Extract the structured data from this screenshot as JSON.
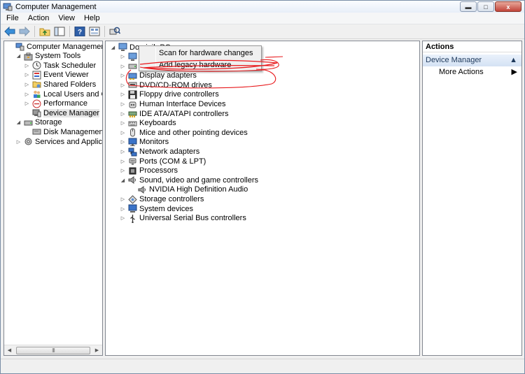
{
  "window": {
    "title": "Computer Management",
    "controls": {
      "minimize": "▬",
      "maximize": "□",
      "close": "x"
    }
  },
  "menu": [
    "File",
    "Action",
    "View",
    "Help"
  ],
  "toolbar": {
    "buttons": [
      "back-arrow-icon",
      "forward-arrow-icon",
      "up-folder-icon",
      "show-hide-tree-icon",
      "help-icon",
      "properties-icon",
      "scan-hardware-icon"
    ]
  },
  "left_tree": [
    {
      "label": "Computer Management (Local",
      "level": 0,
      "toggle": "",
      "icon": "computer-management-icon"
    },
    {
      "label": "System Tools",
      "level": 1,
      "toggle": "◢",
      "icon": "toolbox-icon"
    },
    {
      "label": "Task Scheduler",
      "level": 2,
      "toggle": "▷",
      "icon": "clock-icon"
    },
    {
      "label": "Event Viewer",
      "level": 2,
      "toggle": "▷",
      "icon": "event-viewer-icon"
    },
    {
      "label": "Shared Folders",
      "level": 2,
      "toggle": "▷",
      "icon": "shared-folder-icon"
    },
    {
      "label": "Local Users and Groups",
      "level": 2,
      "toggle": "▷",
      "icon": "users-icon"
    },
    {
      "label": "Performance",
      "level": 2,
      "toggle": "▷",
      "icon": "performance-icon"
    },
    {
      "label": "Device Manager",
      "level": 2,
      "toggle": "",
      "icon": "device-manager-icon",
      "selected": true
    },
    {
      "label": "Storage",
      "level": 1,
      "toggle": "◢",
      "icon": "storage-icon"
    },
    {
      "label": "Disk Management",
      "level": 2,
      "toggle": "",
      "icon": "disk-icon"
    },
    {
      "label": "Services and Applications",
      "level": 1,
      "toggle": "▷",
      "icon": "services-icon"
    }
  ],
  "left_scroll": {
    "grip": "III",
    "left": "◀",
    "right": "▶"
  },
  "device_tree": {
    "root": {
      "label": "Dominik-PC",
      "toggle": "◢"
    },
    "items": [
      {
        "label": "C",
        "toggle": "▷",
        "icon": "computer-icon",
        "level": 1
      },
      {
        "label": "Di",
        "toggle": "▷",
        "icon": "disk-drive-icon",
        "level": 1
      },
      {
        "label": "Display adapters",
        "toggle": "▷",
        "icon": "display-adapter-icon",
        "level": 1
      },
      {
        "label": "DVD/CD-ROM drives",
        "toggle": "▷",
        "icon": "dvd-drive-icon",
        "level": 1
      },
      {
        "label": "Floppy drive controllers",
        "toggle": "▷",
        "icon": "floppy-controller-icon",
        "level": 1
      },
      {
        "label": "Human Interface Devices",
        "toggle": "▷",
        "icon": "hid-icon",
        "level": 1
      },
      {
        "label": "IDE ATA/ATAPI controllers",
        "toggle": "▷",
        "icon": "ide-controller-icon",
        "level": 1
      },
      {
        "label": "Keyboards",
        "toggle": "▷",
        "icon": "keyboard-icon",
        "level": 1
      },
      {
        "label": "Mice and other pointing devices",
        "toggle": "▷",
        "icon": "mouse-icon",
        "level": 1
      },
      {
        "label": "Monitors",
        "toggle": "▷",
        "icon": "monitor-icon",
        "level": 1
      },
      {
        "label": "Network adapters",
        "toggle": "▷",
        "icon": "network-adapter-icon",
        "level": 1
      },
      {
        "label": "Ports (COM & LPT)",
        "toggle": "▷",
        "icon": "port-icon",
        "level": 1
      },
      {
        "label": "Processors",
        "toggle": "▷",
        "icon": "processor-icon",
        "level": 1
      },
      {
        "label": "Sound, video and game controllers",
        "toggle": "◢",
        "icon": "speaker-icon",
        "level": 1
      },
      {
        "label": "NVIDIA High Definition Audio",
        "toggle": "",
        "icon": "speaker-icon",
        "level": 2
      },
      {
        "label": "Storage controllers",
        "toggle": "▷",
        "icon": "storage-controller-icon",
        "level": 1
      },
      {
        "label": "System devices",
        "toggle": "▷",
        "icon": "system-device-icon",
        "level": 1
      },
      {
        "label": "Universal Serial Bus controllers",
        "toggle": "▷",
        "icon": "usb-icon",
        "level": 1
      }
    ]
  },
  "context_menu": {
    "items": [
      "Scan for hardware changes",
      "Add legacy hardware"
    ]
  },
  "actions": {
    "header": "Actions",
    "section": "Device Manager",
    "section_arrow": "▲",
    "more_actions": "More Actions",
    "more_arrow": "▶"
  },
  "colors": {
    "annotation_red": "#e8191c",
    "selection_gray": "#e6e6e6",
    "actions_section": "#d4e2f4"
  }
}
